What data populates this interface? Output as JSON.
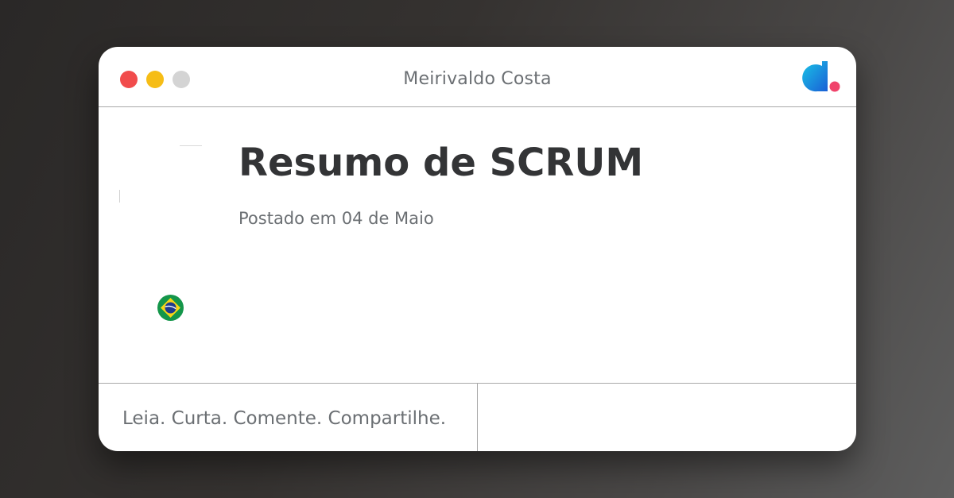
{
  "window": {
    "title": "Meirivaldo Costa",
    "controls": [
      {
        "name": "close",
        "color": "#f14c4c"
      },
      {
        "name": "minimize",
        "color": "#f6bd16"
      },
      {
        "name": "maximize",
        "color": "#d4d4d4"
      }
    ]
  },
  "post": {
    "title": "Resumo de SCRUM",
    "date": "Postado em 04 de Maio"
  },
  "author": {
    "avatar_icon": "avatar",
    "flag_icon": "brazil-flag-icon"
  },
  "footer": {
    "tagline": "Leia. Curta. Comente. Compartilhe."
  },
  "brand": {
    "logo_icon": "dio-logo-icon",
    "colors": {
      "logo_blue": "#1e8fe3",
      "logo_dot": "#f0436b"
    }
  }
}
